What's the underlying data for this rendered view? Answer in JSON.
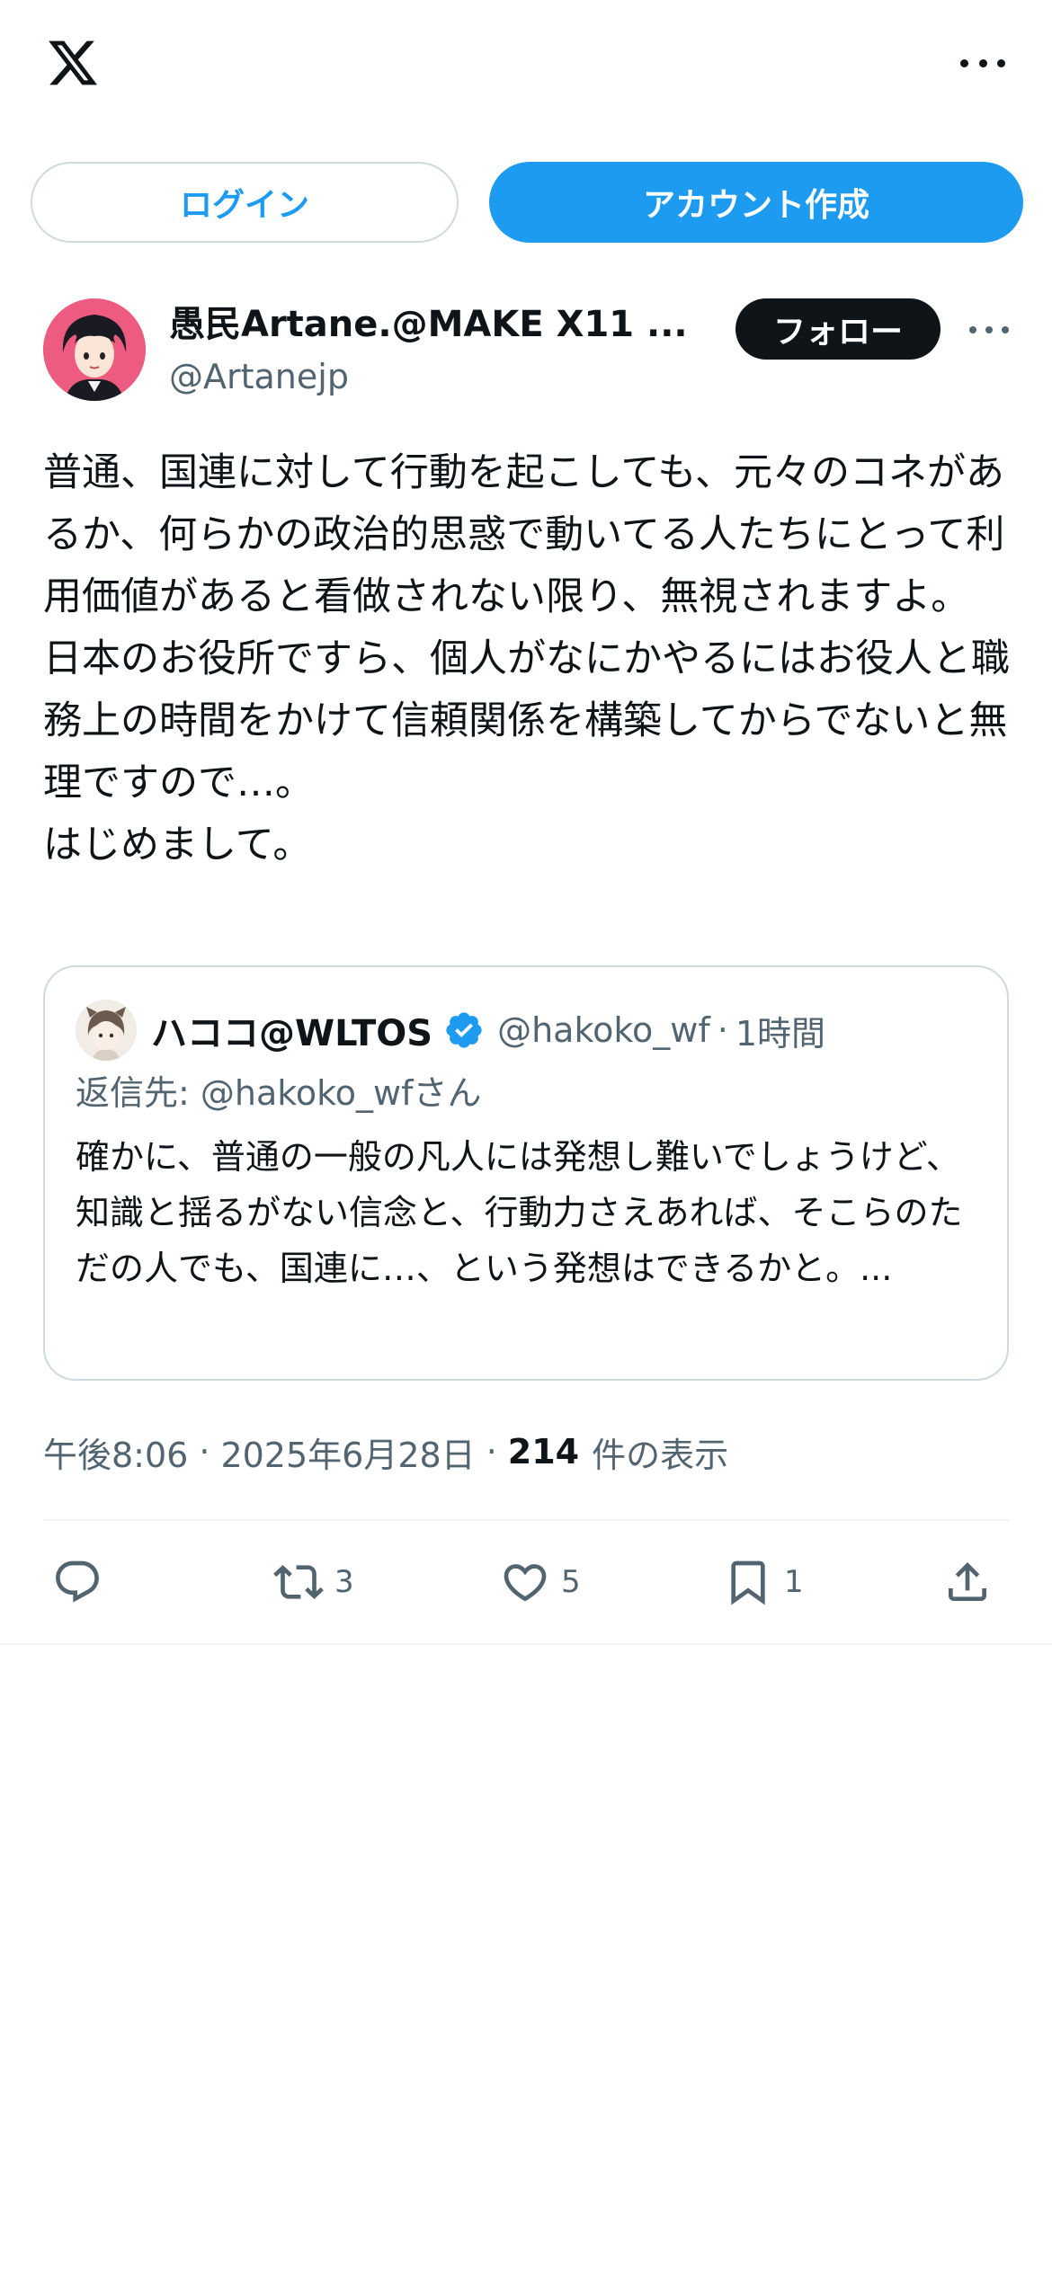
{
  "header": {
    "logo_icon": "x-logo-icon",
    "more_icon": "more-horizontal-icon"
  },
  "auth": {
    "login_label": "ログイン",
    "signup_label": "アカウント作成"
  },
  "post": {
    "display_name": "愚民Artane.@MAKE X11 ...",
    "handle": "@Artanejp",
    "follow_label": "フォロー",
    "body": "普通、国連に対して行動を起こしても、元々のコネがあるか、何らかの政治的思惑で動いてる人たちにとって利用価値があると看做されない限り、無視されますよ。\n日本のお役所ですら、個人がなにかやるにはお役人と職務上の時間をかけて信頼関係を構築してからでないと無理ですので…。\nはじめまして。",
    "time": "午後8:06",
    "date": "2025年6月28日",
    "views_count": "214",
    "views_label": "件の表示",
    "separator": "·"
  },
  "quote": {
    "display_name": "ハココ@WLTOS",
    "handle": "@hakoko_wf",
    "separator": "·",
    "time": "1時間",
    "reply_to": "返信先: @hakoko_wfさん",
    "body": "確かに、普通の一般の凡人には発想し難いでしょうけど、知識と揺るがない信念と、行動力さえあれば、そこらのただの人でも、国連に…、という発想はできるかと。..."
  },
  "actions": {
    "reply": {
      "icon": "reply-icon",
      "count": ""
    },
    "repost": {
      "icon": "repost-icon",
      "count": "3"
    },
    "like": {
      "icon": "heart-icon",
      "count": "5"
    },
    "bookmark": {
      "icon": "bookmark-icon",
      "count": "1"
    },
    "share": {
      "icon": "share-icon",
      "count": ""
    }
  },
  "colors": {
    "accent": "#1d9bf0",
    "text": "#0f1419",
    "secondary": "#536471",
    "border": "#cfd9de"
  }
}
